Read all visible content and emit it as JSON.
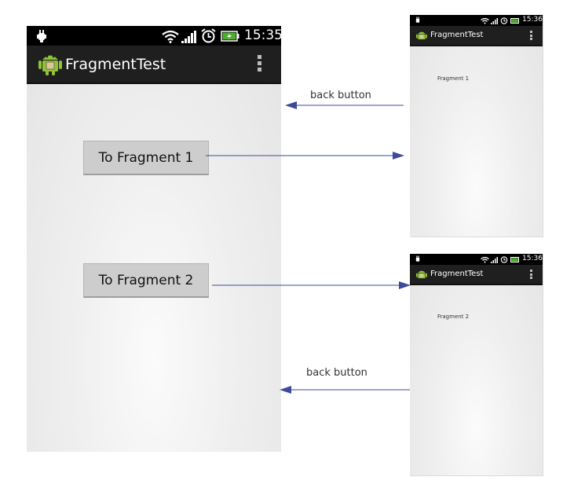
{
  "main_phone": {
    "status_time": "15:35",
    "app_title": "FragmentTest",
    "buttons": {
      "fragment1": "To Fragment 1",
      "fragment2": "To Fragment 2"
    }
  },
  "phone_fragment1": {
    "status_time": "15:36",
    "app_title": "FragmentTest",
    "content": "Fragment 1"
  },
  "phone_fragment2": {
    "status_time": "15:36",
    "app_title": "FragmentTest",
    "content": "Fragment 2"
  },
  "annotations": {
    "back_top": "back button",
    "back_bottom": "back button"
  },
  "colors": {
    "arrow": "#3d4a9a",
    "battery": "#4caf2a",
    "android": "#8fc23a"
  }
}
